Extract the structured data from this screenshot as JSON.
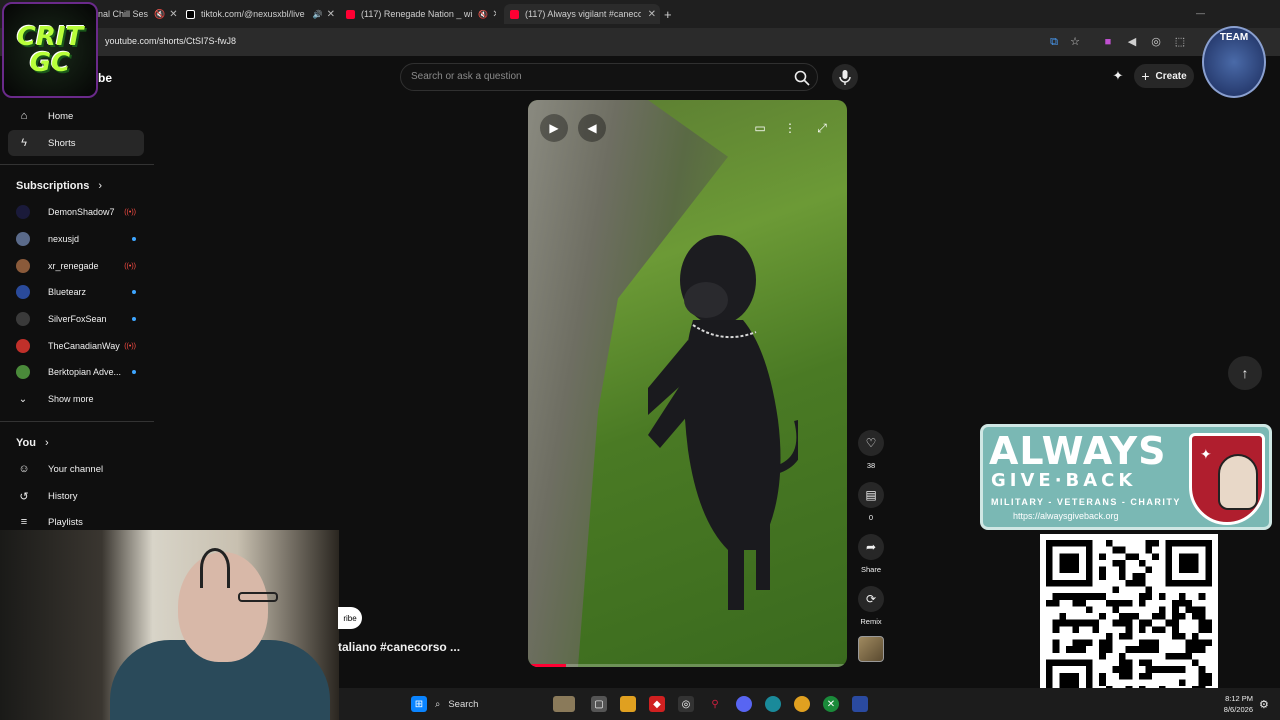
{
  "browser": {
    "tabs": [
      {
        "label": "nal Chill Ses"
      },
      {
        "label": "tiktok.com/@nexusxbl/live"
      },
      {
        "label": "(117) Renegade Nation _ wi"
      },
      {
        "label": "(117) Always vigilant #canecor"
      }
    ],
    "new_tab": "+",
    "url": "youtube.com/shorts/CtSI7S-fwJ8"
  },
  "overlay": {
    "crit_logo_line1": "CRIT",
    "crit_logo_line2": "GC",
    "team_logo": "TEAM"
  },
  "header": {
    "brand_fragment": "be",
    "search_placeholder": "Search or ask a question",
    "create_label": "Create"
  },
  "sidebar": {
    "nav": [
      {
        "label": "Home",
        "icon": "home-icon"
      },
      {
        "label": "Shorts",
        "icon": "shorts-icon"
      }
    ],
    "subscriptions_heading": "Subscriptions",
    "subscriptions": [
      {
        "name": "DemonShadow7",
        "status": "live",
        "color": "#1a1a3a"
      },
      {
        "name": "nexusjd",
        "status": "new",
        "color": "#5a6a8a"
      },
      {
        "name": "xr_renegade",
        "status": "live",
        "color": "#8a5a3a"
      },
      {
        "name": "Bluetearz",
        "status": "new",
        "color": "#2a4a9a"
      },
      {
        "name": "SilverFoxSean",
        "status": "new",
        "color": "#3a3a3a"
      },
      {
        "name": "TheCanadianWay",
        "status": "live",
        "color": "#c0302a"
      },
      {
        "name": "Berktopian Adve...",
        "status": "new",
        "color": "#4a8a3a"
      }
    ],
    "show_more": "Show more",
    "you_heading": "You",
    "you_items": [
      {
        "label": "Your channel",
        "icon": "person-icon"
      },
      {
        "label": "History",
        "icon": "history-icon"
      },
      {
        "label": "Playlists",
        "icon": "playlist-icon"
      }
    ]
  },
  "short": {
    "title": "taliano #canecorso ...",
    "subscribe_fragment": "ribe",
    "progress": 0.12
  },
  "actions": {
    "likes": "38",
    "comments": "0",
    "share": "Share",
    "remix": "Remix"
  },
  "banner": {
    "line1": "ALWAYS",
    "line2": "GIVE·BACK",
    "tagline": "MILITARY - VETERANS - CHARITY",
    "url": "https://alwaysgiveback.org",
    "colors": {
      "background": "#7ab8b4",
      "shield": "#b01e2e"
    }
  },
  "taskbar": {
    "search_label": "Search",
    "time": "8:12 PM",
    "date": "8/6/2026"
  }
}
